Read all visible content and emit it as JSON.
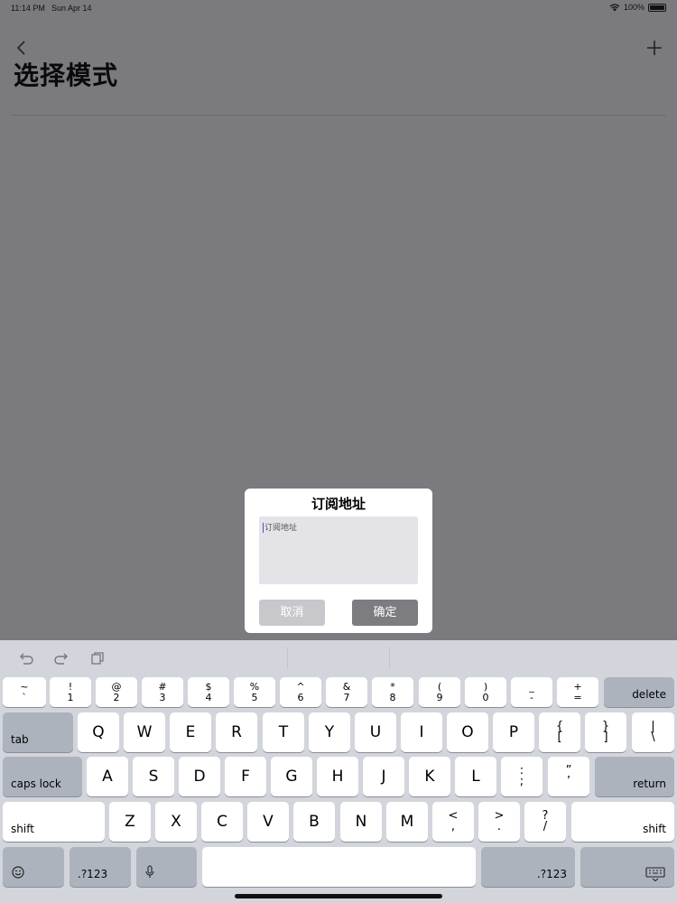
{
  "status_bar": {
    "time": "11:14 PM",
    "date": "Sun Apr 14",
    "battery": "100%"
  },
  "nav": {
    "title": "选择模式",
    "back_icon": "chevron-left-icon",
    "add_icon": "plus-icon"
  },
  "dialog": {
    "title": "订阅地址",
    "input_placeholder": "订阅地址",
    "cancel_label": "取消",
    "confirm_label": "确定"
  },
  "keyboard": {
    "toolbar_icons": [
      "undo-icon",
      "redo-icon",
      "paste-icon"
    ],
    "row1": [
      {
        "top": "~",
        "bottom": "`"
      },
      {
        "top": "!",
        "bottom": "1"
      },
      {
        "top": "@",
        "bottom": "2"
      },
      {
        "top": "#",
        "bottom": "3"
      },
      {
        "top": "$",
        "bottom": "4"
      },
      {
        "top": "%",
        "bottom": "5"
      },
      {
        "top": "^",
        "bottom": "6"
      },
      {
        "top": "&",
        "bottom": "7"
      },
      {
        "top": "*",
        "bottom": "8"
      },
      {
        "top": "(",
        "bottom": "9"
      },
      {
        "top": ")",
        "bottom": "0"
      },
      {
        "top": "_",
        "bottom": "-"
      },
      {
        "top": "+",
        "bottom": "="
      }
    ],
    "delete_label": "delete",
    "tab_label": "tab",
    "row2": [
      "Q",
      "W",
      "E",
      "R",
      "T",
      "Y",
      "U",
      "I",
      "O",
      "P"
    ],
    "row2_symbols": [
      {
        "top": "{",
        "bottom": "["
      },
      {
        "top": "}",
        "bottom": "]"
      },
      {
        "top": "|",
        "bottom": "\\"
      }
    ],
    "caps_label": "caps lock",
    "row3": [
      "A",
      "S",
      "D",
      "F",
      "G",
      "H",
      "J",
      "K",
      "L"
    ],
    "row3_symbols": [
      {
        "top": ":",
        "bottom": ";"
      },
      {
        "top": "”",
        "bottom": "’"
      }
    ],
    "return_label": "return",
    "shift_label": "shift",
    "row4": [
      "Z",
      "X",
      "C",
      "V",
      "B",
      "N",
      "M"
    ],
    "row4_symbols": [
      {
        "top": "<",
        "bottom": ","
      },
      {
        "top": ">",
        "bottom": "."
      },
      {
        "top": "?",
        "bottom": "/"
      }
    ],
    "numbers_label": ".?123",
    "emoji_icon": "emoji-icon",
    "mic_icon": "microphone-icon",
    "dismiss_icon": "keyboard-dismiss-icon"
  }
}
